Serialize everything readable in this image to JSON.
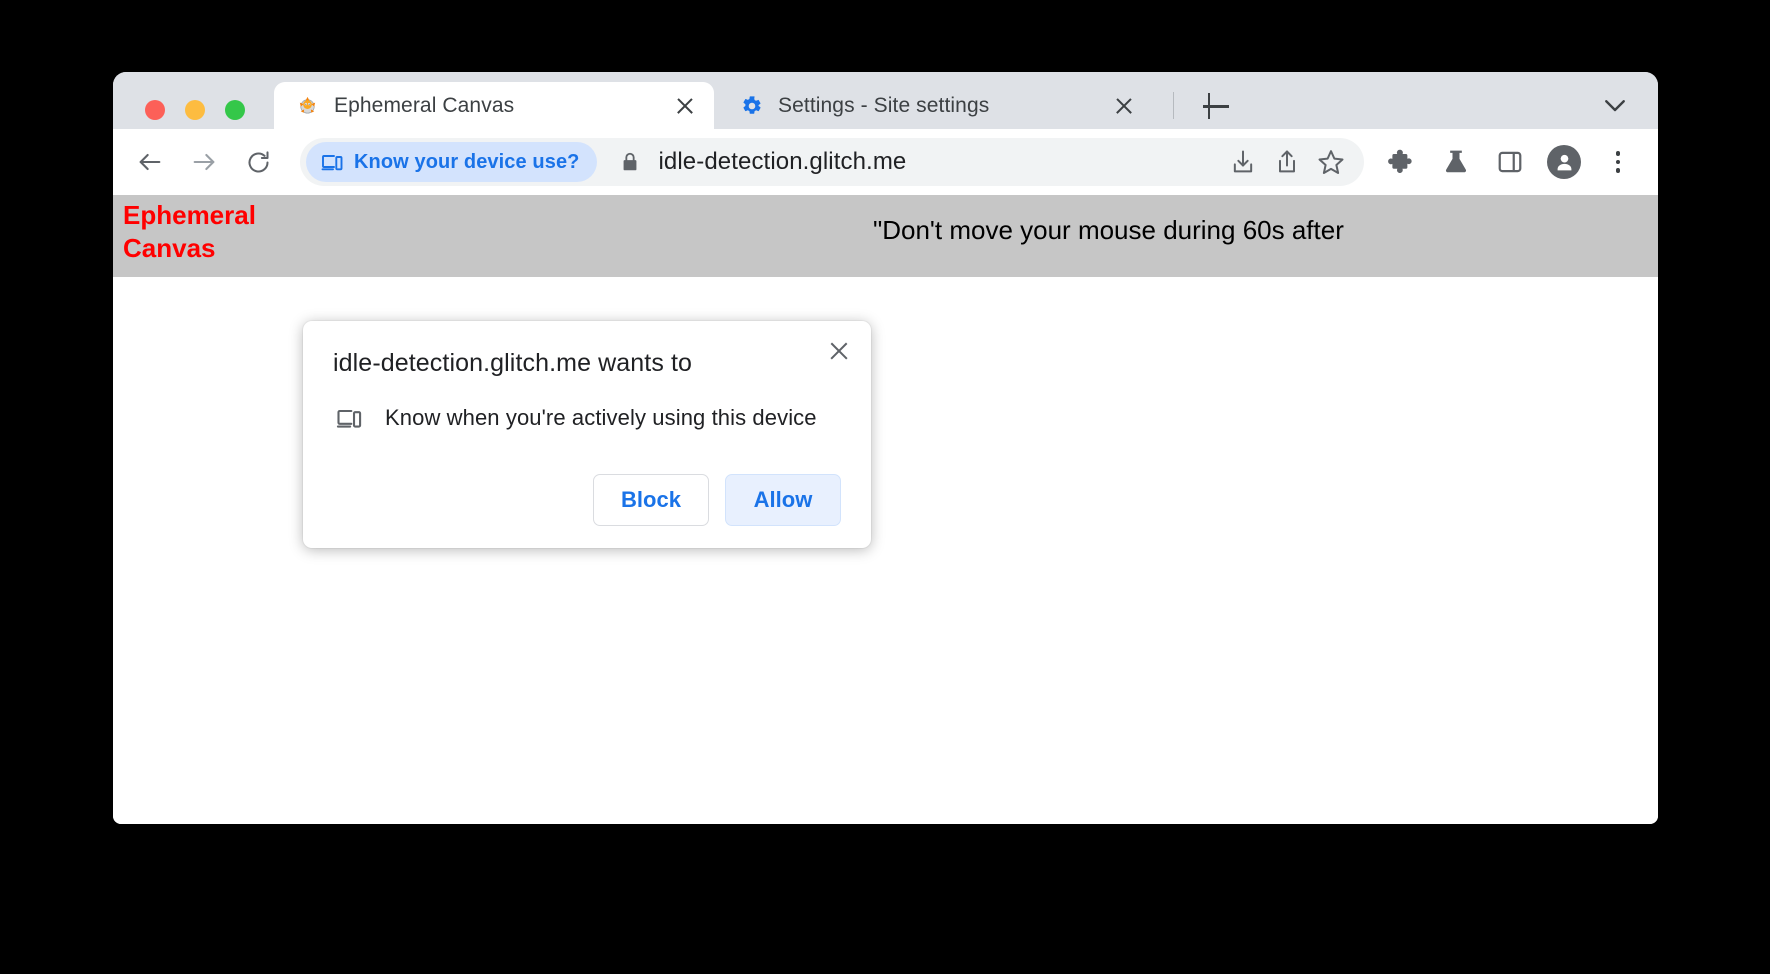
{
  "window": {
    "traffic_lights": [
      {
        "name": "close",
        "color": "#fc6058"
      },
      {
        "name": "minimize",
        "color": "#fdbc40"
      },
      {
        "name": "zoom",
        "color": "#34c749"
      }
    ]
  },
  "tabs": [
    {
      "title": "Ephemeral Canvas",
      "favicon": "pufferfish-icon",
      "active": true
    },
    {
      "title": "Settings - Site settings",
      "favicon": "gear-icon",
      "active": false
    }
  ],
  "tabstrip": {
    "new_tab_label": "+",
    "tab_search_icon": "chevron-down-icon"
  },
  "toolbar": {
    "back_icon": "back-arrow-icon",
    "forward_icon": "forward-arrow-icon",
    "reload_icon": "reload-icon",
    "chip_label": "Know your device use?",
    "chip_icon": "device-idle-icon",
    "chip_color": "#1a73e8",
    "chip_background": "#d3e3fd",
    "lock_icon": "lock-icon",
    "url": "idle-detection.glitch.me",
    "download_icon": "download-icon",
    "share_icon": "share-icon",
    "bookmark_icon": "star-icon",
    "extensions_icon": "puzzle-piece-icon",
    "experiments_icon": "flask-icon",
    "side_panel_icon": "side-panel-icon",
    "profile_icon": "avatar-icon",
    "menu_icon": "three-dot-menu-icon"
  },
  "page": {
    "heading": "Ephemeral Canvas",
    "heading_color": "#ff0000",
    "banner_background": "#c6c6c6",
    "note": "\"Don't move your mouse during 60s after"
  },
  "dialog": {
    "title": "idle-detection.glitch.me wants to",
    "permission_icon": "device-idle-icon",
    "permission_text": "Know when you're actively using this device",
    "block_label": "Block",
    "allow_label": "Allow",
    "close_icon": "close-icon",
    "accent_color": "#1a73e8"
  }
}
